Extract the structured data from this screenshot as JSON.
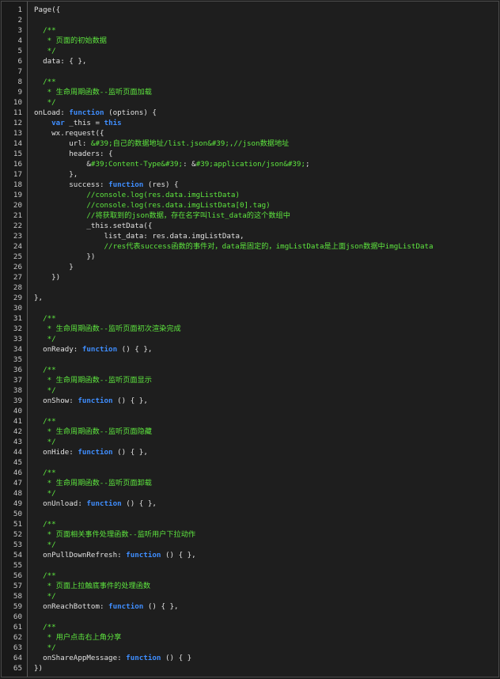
{
  "colors": {
    "background": "#1e1e1e",
    "gutter": "#191919",
    "comment": "#5ee63f",
    "keyword": "#3f8eff",
    "text": "#e0e0e0",
    "line_number": "#c8c8c8"
  },
  "lines": [
    {
      "n": "1",
      "tokens": [
        {
          "t": "plain",
          "v": "Page({"
        }
      ]
    },
    {
      "n": "2",
      "tokens": []
    },
    {
      "n": "3",
      "tokens": [
        {
          "t": "comment",
          "v": "  /**"
        }
      ]
    },
    {
      "n": "4",
      "tokens": [
        {
          "t": "comment",
          "v": "   * 页面的初始数据"
        }
      ]
    },
    {
      "n": "5",
      "tokens": [
        {
          "t": "comment",
          "v": "   */"
        }
      ]
    },
    {
      "n": "6",
      "tokens": [
        {
          "t": "plain",
          "v": "  data: { },"
        }
      ]
    },
    {
      "n": "7",
      "tokens": []
    },
    {
      "n": "8",
      "tokens": [
        {
          "t": "comment",
          "v": "  /**"
        }
      ]
    },
    {
      "n": "9",
      "tokens": [
        {
          "t": "comment",
          "v": "   * 生命周期函数--监听页面加载"
        }
      ]
    },
    {
      "n": "10",
      "tokens": [
        {
          "t": "comment",
          "v": "   */"
        }
      ]
    },
    {
      "n": "11",
      "tokens": [
        {
          "t": "plain",
          "v": "onLoad: "
        },
        {
          "t": "keyword",
          "v": "function"
        },
        {
          "t": "plain",
          "v": " (options) {"
        }
      ]
    },
    {
      "n": "12",
      "tokens": [
        {
          "t": "plain",
          "v": "    "
        },
        {
          "t": "keyword",
          "v": "var"
        },
        {
          "t": "plain",
          "v": " _this = "
        },
        {
          "t": "keyword",
          "v": "this"
        }
      ]
    },
    {
      "n": "13",
      "tokens": [
        {
          "t": "plain",
          "v": "    wx.request({"
        }
      ]
    },
    {
      "n": "14",
      "tokens": [
        {
          "t": "plain",
          "v": "        url: "
        },
        {
          "t": "string",
          "v": "&#39;自己的数据地址/list.json&#39;,//json数据地址"
        }
      ]
    },
    {
      "n": "15",
      "tokens": [
        {
          "t": "plain",
          "v": "        headers: {"
        }
      ]
    },
    {
      "n": "16",
      "tokens": [
        {
          "t": "plain",
          "v": "            &"
        },
        {
          "t": "string",
          "v": "#39;Content-Type&#39;"
        },
        {
          "t": "plain",
          "v": ": &"
        },
        {
          "t": "string",
          "v": "#39;application/json&#39;"
        },
        {
          "t": "plain",
          "v": ";"
        }
      ]
    },
    {
      "n": "17",
      "tokens": [
        {
          "t": "plain",
          "v": "        },"
        }
      ]
    },
    {
      "n": "18",
      "tokens": [
        {
          "t": "plain",
          "v": "        success: "
        },
        {
          "t": "keyword",
          "v": "function"
        },
        {
          "t": "plain",
          "v": " (res) {"
        }
      ]
    },
    {
      "n": "19",
      "tokens": [
        {
          "t": "comment",
          "v": "            //console.log(res.data.imgListData)"
        }
      ]
    },
    {
      "n": "20",
      "tokens": [
        {
          "t": "comment",
          "v": "            //console.log(res.data.imgListData[0].tag)"
        }
      ]
    },
    {
      "n": "21",
      "tokens": [
        {
          "t": "comment",
          "v": "            //将获取到的json数据，存在名字叫list_data的这个数组中"
        }
      ]
    },
    {
      "n": "22",
      "tokens": [
        {
          "t": "plain",
          "v": "            _this.setData({"
        }
      ]
    },
    {
      "n": "23",
      "tokens": [
        {
          "t": "plain",
          "v": "                list_data: res.data.imgListData,"
        }
      ]
    },
    {
      "n": "24",
      "tokens": [
        {
          "t": "comment",
          "v": "                //res代表success函数的事件对，data是固定的，imgListData是上面json数据中imgListData"
        }
      ]
    },
    {
      "n": "25",
      "tokens": [
        {
          "t": "plain",
          "v": "            })"
        }
      ]
    },
    {
      "n": "26",
      "tokens": [
        {
          "t": "plain",
          "v": "        }"
        }
      ]
    },
    {
      "n": "27",
      "tokens": [
        {
          "t": "plain",
          "v": "    })"
        }
      ]
    },
    {
      "n": "28",
      "tokens": []
    },
    {
      "n": "29",
      "tokens": [
        {
          "t": "plain",
          "v": "},"
        }
      ]
    },
    {
      "n": "30",
      "tokens": []
    },
    {
      "n": "31",
      "tokens": [
        {
          "t": "comment",
          "v": "  /**"
        }
      ]
    },
    {
      "n": "32",
      "tokens": [
        {
          "t": "comment",
          "v": "   * 生命周期函数--监听页面初次渲染完成"
        }
      ]
    },
    {
      "n": "33",
      "tokens": [
        {
          "t": "comment",
          "v": "   */"
        }
      ]
    },
    {
      "n": "34",
      "tokens": [
        {
          "t": "plain",
          "v": "  onReady: "
        },
        {
          "t": "keyword",
          "v": "function"
        },
        {
          "t": "plain",
          "v": " () { },"
        }
      ]
    },
    {
      "n": "35",
      "tokens": []
    },
    {
      "n": "36",
      "tokens": [
        {
          "t": "comment",
          "v": "  /**"
        }
      ]
    },
    {
      "n": "37",
      "tokens": [
        {
          "t": "comment",
          "v": "   * 生命周期函数--监听页面显示"
        }
      ]
    },
    {
      "n": "38",
      "tokens": [
        {
          "t": "comment",
          "v": "   */"
        }
      ]
    },
    {
      "n": "39",
      "tokens": [
        {
          "t": "plain",
          "v": "  onShow: "
        },
        {
          "t": "keyword",
          "v": "function"
        },
        {
          "t": "plain",
          "v": " () { },"
        }
      ]
    },
    {
      "n": "40",
      "tokens": []
    },
    {
      "n": "41",
      "tokens": [
        {
          "t": "comment",
          "v": "  /**"
        }
      ]
    },
    {
      "n": "42",
      "tokens": [
        {
          "t": "comment",
          "v": "   * 生命周期函数--监听页面隐藏"
        }
      ]
    },
    {
      "n": "43",
      "tokens": [
        {
          "t": "comment",
          "v": "   */"
        }
      ]
    },
    {
      "n": "44",
      "tokens": [
        {
          "t": "plain",
          "v": "  onHide: "
        },
        {
          "t": "keyword",
          "v": "function"
        },
        {
          "t": "plain",
          "v": " () { },"
        }
      ]
    },
    {
      "n": "45",
      "tokens": []
    },
    {
      "n": "46",
      "tokens": [
        {
          "t": "comment",
          "v": "  /**"
        }
      ]
    },
    {
      "n": "47",
      "tokens": [
        {
          "t": "comment",
          "v": "   * 生命周期函数--监听页面卸载"
        }
      ]
    },
    {
      "n": "48",
      "tokens": [
        {
          "t": "comment",
          "v": "   */"
        }
      ]
    },
    {
      "n": "49",
      "tokens": [
        {
          "t": "plain",
          "v": "  onUnload: "
        },
        {
          "t": "keyword",
          "v": "function"
        },
        {
          "t": "plain",
          "v": " () { },"
        }
      ]
    },
    {
      "n": "50",
      "tokens": []
    },
    {
      "n": "51",
      "tokens": [
        {
          "t": "comment",
          "v": "  /**"
        }
      ]
    },
    {
      "n": "52",
      "tokens": [
        {
          "t": "comment",
          "v": "   * 页面相关事件处理函数--监听用户下拉动作"
        }
      ]
    },
    {
      "n": "53",
      "tokens": [
        {
          "t": "comment",
          "v": "   */"
        }
      ]
    },
    {
      "n": "54",
      "tokens": [
        {
          "t": "plain",
          "v": "  onPullDownRefresh: "
        },
        {
          "t": "keyword",
          "v": "function"
        },
        {
          "t": "plain",
          "v": " () { },"
        }
      ]
    },
    {
      "n": "55",
      "tokens": []
    },
    {
      "n": "56",
      "tokens": [
        {
          "t": "comment",
          "v": "  /**"
        }
      ]
    },
    {
      "n": "57",
      "tokens": [
        {
          "t": "comment",
          "v": "   * 页面上拉触底事件的处理函数"
        }
      ]
    },
    {
      "n": "58",
      "tokens": [
        {
          "t": "comment",
          "v": "   */"
        }
      ]
    },
    {
      "n": "59",
      "tokens": [
        {
          "t": "plain",
          "v": "  onReachBottom: "
        },
        {
          "t": "keyword",
          "v": "function"
        },
        {
          "t": "plain",
          "v": " () { },"
        }
      ]
    },
    {
      "n": "60",
      "tokens": []
    },
    {
      "n": "61",
      "tokens": [
        {
          "t": "comment",
          "v": "  /**"
        }
      ]
    },
    {
      "n": "62",
      "tokens": [
        {
          "t": "comment",
          "v": "   * 用户点击右上角分享"
        }
      ]
    },
    {
      "n": "63",
      "tokens": [
        {
          "t": "comment",
          "v": "   */"
        }
      ]
    },
    {
      "n": "64",
      "tokens": [
        {
          "t": "plain",
          "v": "  onShareAppMessage: "
        },
        {
          "t": "keyword",
          "v": "function"
        },
        {
          "t": "plain",
          "v": " () { }"
        }
      ]
    },
    {
      "n": "65",
      "tokens": [
        {
          "t": "plain",
          "v": "})"
        }
      ]
    }
  ]
}
